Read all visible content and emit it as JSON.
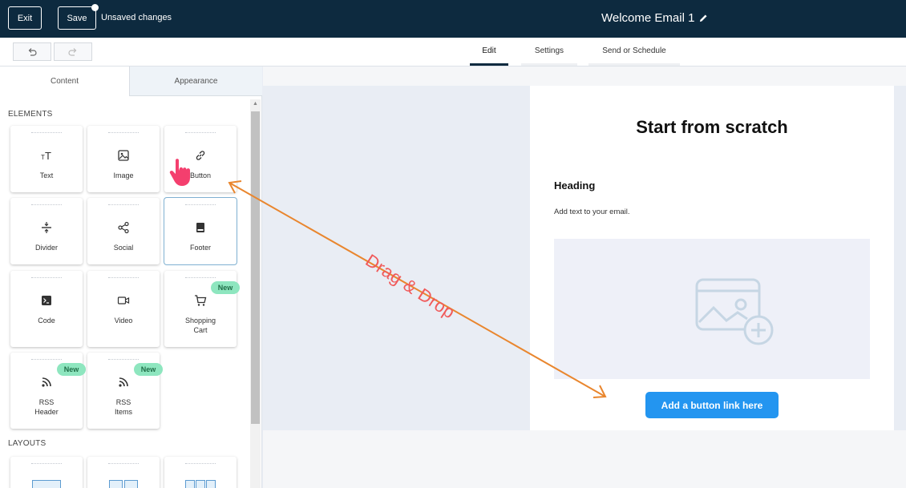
{
  "topbar": {
    "exit_label": "Exit",
    "save_label": "Save",
    "unsaved_label": "Unsaved changes",
    "title": "Welcome Email 1"
  },
  "tabs": [
    {
      "label": "Edit",
      "active": true
    },
    {
      "label": "Settings",
      "active": false
    },
    {
      "label": "Send or Schedule",
      "active": false
    }
  ],
  "left_panel": {
    "tabs": [
      {
        "label": "Content",
        "active": true
      },
      {
        "label": "Appearance",
        "active": false
      }
    ],
    "elements_label": "ELEMENTS",
    "layouts_label": "LAYOUTS",
    "elements": [
      {
        "label": "Text",
        "icon": "text-size-icon"
      },
      {
        "label": "Image",
        "icon": "image-icon"
      },
      {
        "label": "Button",
        "icon": "link-icon"
      },
      {
        "label": "Divider",
        "icon": "divider-icon"
      },
      {
        "label": "Social",
        "icon": "share-icon"
      },
      {
        "label": "Footer",
        "icon": "footer-icon"
      },
      {
        "label": "Code",
        "icon": "code-icon"
      },
      {
        "label": "Video",
        "icon": "video-icon"
      },
      {
        "label": "Shopping",
        "label2": "Cart",
        "icon": "cart-icon",
        "badge": "New"
      },
      {
        "label": "RSS",
        "label2": "Header",
        "icon": "rss-icon",
        "badge": "New"
      },
      {
        "label": "RSS",
        "label2": "Items",
        "icon": "rss-icon",
        "badge": "New"
      }
    ]
  },
  "email": {
    "title": "Start from scratch",
    "heading": "Heading",
    "body_text": "Add text to your email.",
    "button_label": "Add a button link here"
  },
  "annotation": {
    "text": "Drag & Drop",
    "color": "#f05a5a",
    "arrow_color": "#e9862e"
  },
  "colors": {
    "topbar": "#0d2a3f",
    "button_blue": "#2395f0",
    "badge_green": "#8ee6bf"
  }
}
